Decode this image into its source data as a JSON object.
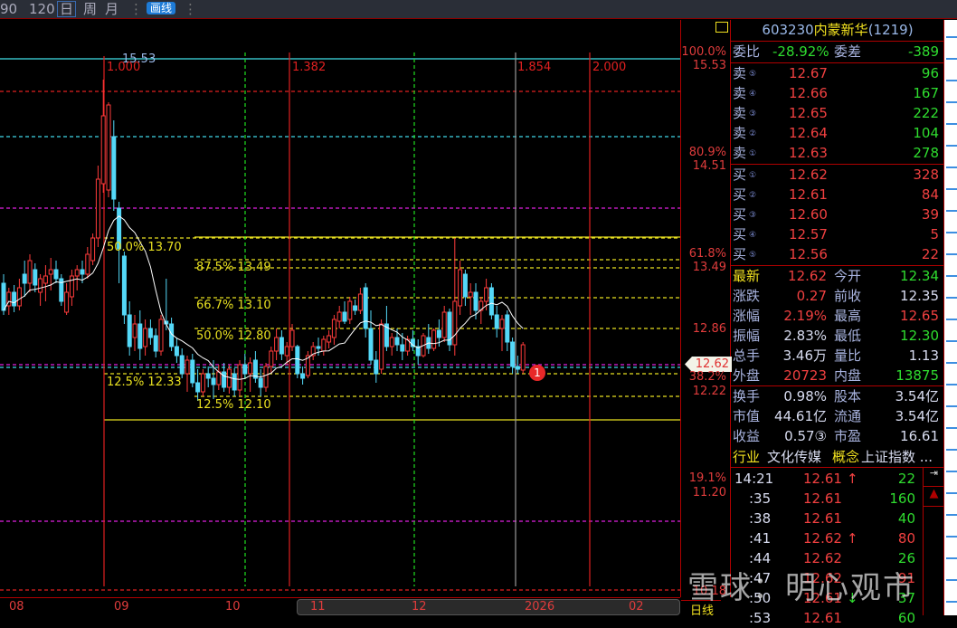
{
  "toolbar": {
    "items": [
      "90",
      "120",
      "日",
      "周",
      "月"
    ],
    "selected": "日",
    "draw_button": "画线"
  },
  "chart": {
    "top_price_label": "15.53",
    "ratios": [
      "1.000",
      "1.382",
      "1.854",
      "2.000"
    ],
    "fib_labels": [
      "50.0% 13.70",
      "87.5% 13.49",
      "66.7% 13.10",
      "50.0% 12.80",
      "12.5% 12.33",
      "12.5% 12.10"
    ],
    "marker": "1",
    "colors": {
      "up": "#ff3b3b",
      "down": "#54d8f8",
      "ma": "#ffffff"
    },
    "ohlc": [
      [
        13.3,
        13.4,
        12.95,
        13.0
      ],
      [
        13.05,
        13.25,
        12.95,
        13.2
      ],
      [
        13.2,
        13.28,
        12.98,
        13.05
      ],
      [
        13.05,
        13.35,
        13.0,
        13.25
      ],
      [
        13.4,
        13.55,
        13.15,
        13.3
      ],
      [
        13.3,
        13.62,
        13.2,
        13.55
      ],
      [
        13.45,
        13.52,
        13.2,
        13.28
      ],
      [
        13.2,
        13.4,
        13.05,
        13.35
      ],
      [
        13.3,
        13.5,
        13.1,
        13.38
      ],
      [
        13.4,
        13.58,
        13.22,
        13.45
      ],
      [
        13.45,
        13.55,
        13.3,
        13.35
      ],
      [
        13.35,
        13.4,
        13.05,
        13.1
      ],
      [
        12.98,
        13.3,
        12.95,
        13.2
      ],
      [
        13.15,
        13.45,
        13.05,
        13.38
      ],
      [
        13.38,
        13.5,
        13.22,
        13.45
      ],
      [
        13.45,
        13.55,
        13.3,
        13.4
      ],
      [
        13.4,
        13.7,
        13.35,
        13.62
      ],
      [
        13.55,
        13.85,
        13.5,
        13.8
      ],
      [
        13.8,
        14.6,
        13.7,
        14.45
      ],
      [
        14.4,
        15.55,
        14.3,
        15.15
      ],
      [
        14.33,
        15.3,
        14.25,
        15.27
      ],
      [
        14.92,
        15.1,
        14.1,
        14.23
      ],
      [
        14.13,
        14.2,
        13.3,
        13.68
      ],
      [
        13.6,
        13.65,
        12.85,
        12.95
      ],
      [
        12.95,
        13.1,
        12.5,
        12.6
      ],
      [
        12.7,
        12.95,
        12.55,
        12.85
      ],
      [
        12.85,
        13.0,
        12.45,
        12.58
      ],
      [
        12.6,
        12.9,
        12.5,
        12.8
      ],
      [
        12.8,
        12.9,
        12.62,
        12.7
      ],
      [
        12.72,
        12.8,
        12.48,
        12.55
      ],
      [
        12.55,
        12.95,
        12.5,
        12.9
      ],
      [
        12.88,
        13.35,
        12.78,
        12.85
      ],
      [
        12.85,
        12.92,
        12.55,
        12.6
      ],
      [
        12.6,
        12.7,
        12.42,
        12.5
      ],
      [
        12.5,
        12.58,
        12.25,
        12.3
      ],
      [
        12.3,
        12.5,
        12.1,
        12.45
      ],
      [
        12.45,
        12.52,
        12.15,
        12.2
      ],
      [
        12.2,
        12.35,
        12.0,
        12.1
      ],
      [
        12.1,
        12.35,
        12.05,
        12.3
      ],
      [
        12.3,
        12.38,
        12.15,
        12.25
      ],
      [
        12.25,
        12.45,
        12.02,
        12.18
      ],
      [
        12.18,
        12.4,
        12.12,
        12.32
      ],
      [
        12.32,
        12.42,
        12.1,
        12.15
      ],
      [
        12.15,
        12.4,
        12.08,
        12.35
      ],
      [
        12.3,
        12.36,
        12.05,
        12.12
      ],
      [
        12.12,
        12.45,
        12.05,
        12.4
      ],
      [
        12.4,
        12.52,
        12.25,
        12.3
      ],
      [
        12.3,
        12.48,
        12.1,
        12.42
      ],
      [
        12.45,
        12.55,
        12.2,
        12.25
      ],
      [
        12.25,
        12.35,
        12.05,
        12.15
      ],
      [
        12.15,
        12.42,
        12.1,
        12.38
      ],
      [
        12.38,
        12.6,
        12.3,
        12.55
      ],
      [
        12.55,
        12.8,
        12.45,
        12.7
      ],
      [
        12.7,
        12.78,
        12.45,
        12.52
      ],
      [
        12.5,
        12.65,
        12.4,
        12.6
      ],
      [
        12.6,
        12.85,
        12.55,
        12.78
      ],
      [
        12.6,
        12.62,
        12.25,
        12.3
      ],
      [
        12.3,
        12.38,
        12.18,
        12.25
      ],
      [
        12.28,
        12.55,
        12.25,
        12.5
      ],
      [
        12.5,
        12.65,
        12.45,
        12.6
      ],
      [
        12.6,
        12.7,
        12.5,
        12.58
      ],
      [
        12.55,
        12.72,
        12.5,
        12.68
      ],
      [
        12.65,
        12.78,
        12.58,
        12.72
      ],
      [
        12.7,
        12.95,
        12.62,
        12.9
      ],
      [
        12.88,
        13.05,
        12.8,
        12.98
      ],
      [
        12.98,
        13.1,
        12.85,
        12.88
      ],
      [
        12.9,
        13.15,
        12.85,
        13.1
      ],
      [
        13.05,
        13.12,
        12.95,
        13.0
      ],
      [
        13.0,
        13.25,
        12.96,
        13.18
      ],
      [
        13.25,
        13.3,
        12.7,
        12.8
      ],
      [
        12.8,
        13.0,
        12.4,
        12.45
      ],
      [
        12.45,
        12.55,
        12.2,
        12.3
      ],
      [
        12.35,
        12.9,
        12.3,
        12.85
      ],
      [
        12.85,
        13.05,
        12.55,
        12.6
      ],
      [
        12.6,
        12.75,
        12.5,
        12.7
      ],
      [
        12.7,
        12.8,
        12.55,
        12.62
      ],
      [
        12.62,
        12.75,
        12.45,
        12.55
      ],
      [
        12.55,
        12.72,
        12.5,
        12.68
      ],
      [
        12.68,
        12.78,
        12.55,
        12.6
      ],
      [
        12.6,
        12.68,
        12.4,
        12.5
      ],
      [
        12.5,
        12.75,
        12.48,
        12.72
      ],
      [
        12.7,
        12.85,
        12.52,
        12.58
      ],
      [
        12.58,
        12.8,
        12.55,
        12.78
      ],
      [
        12.78,
        12.9,
        12.6,
        12.7
      ],
      [
        12.7,
        13.05,
        12.65,
        12.98
      ],
      [
        12.98,
        13.02,
        12.55,
        12.62
      ],
      [
        12.62,
        13.8,
        12.5,
        13.1
      ],
      [
        13.05,
        13.55,
        12.95,
        13.45
      ],
      [
        13.4,
        13.45,
        13.05,
        13.15
      ],
      [
        13.15,
        13.3,
        12.95,
        13.2
      ],
      [
        13.2,
        13.3,
        12.9,
        13.0
      ],
      [
        13.0,
        13.15,
        12.85,
        13.1
      ],
      [
        13.1,
        13.35,
        13.0,
        13.25
      ],
      [
        13.25,
        13.3,
        12.9,
        12.95
      ],
      [
        12.95,
        13.05,
        12.7,
        12.8
      ],
      [
        12.8,
        12.95,
        12.55,
        12.9
      ],
      [
        12.95,
        13.0,
        12.55,
        12.65
      ],
      [
        12.65,
        12.7,
        12.3,
        12.38
      ],
      [
        12.38,
        12.5,
        12.3,
        12.35
      ],
      [
        12.34,
        12.65,
        12.3,
        12.62
      ]
    ]
  },
  "axis": {
    "labels": [
      [
        "100.0%",
        "15.53"
      ],
      [
        "80.9%",
        "14.51"
      ],
      [
        "61.8%",
        "13.49"
      ],
      [
        "",
        "12.86"
      ],
      [
        "38.2%",
        "12.22"
      ],
      [
        "19.1%",
        "11.20"
      ],
      [
        "",
        "10.18"
      ]
    ],
    "current": "12.62",
    "period": "日线"
  },
  "dates": [
    "08",
    "09",
    "10",
    "11",
    "12",
    "2026",
    "02"
  ],
  "panel": {
    "code": "603230",
    "name": "内蒙新华",
    "count": "(1219)",
    "weibi_label": "委比",
    "weibi": "-28.92%",
    "weicha_label": "委差",
    "weicha": "-389",
    "sells": [
      {
        "l": "卖",
        "n": "⑤",
        "p": "12.67",
        "v": "96"
      },
      {
        "l": "卖",
        "n": "④",
        "p": "12.66",
        "v": "167"
      },
      {
        "l": "卖",
        "n": "③",
        "p": "12.65",
        "v": "222"
      },
      {
        "l": "卖",
        "n": "②",
        "p": "12.64",
        "v": "104"
      },
      {
        "l": "卖",
        "n": "①",
        "p": "12.63",
        "v": "278"
      }
    ],
    "buys": [
      {
        "l": "买",
        "n": "①",
        "p": "12.62",
        "v": "328"
      },
      {
        "l": "买",
        "n": "②",
        "p": "12.61",
        "v": "84"
      },
      {
        "l": "买",
        "n": "③",
        "p": "12.60",
        "v": "39"
      },
      {
        "l": "买",
        "n": "④",
        "p": "12.57",
        "v": "5"
      },
      {
        "l": "买",
        "n": "⑤",
        "p": "12.56",
        "v": "22"
      }
    ],
    "stats": [
      [
        "最新",
        "12.62",
        "今开",
        "12.34"
      ],
      [
        "涨跌",
        "0.27",
        "前收",
        "12.35"
      ],
      [
        "涨幅",
        "2.19%",
        "最高",
        "12.65"
      ],
      [
        "振幅",
        "2.83%",
        "最低",
        "12.30"
      ],
      [
        "总手",
        "3.46万",
        "量比",
        "1.13"
      ],
      [
        "外盘",
        "20723",
        "内盘",
        "13875"
      ]
    ],
    "info": [
      [
        "换手",
        "0.98%",
        "股本",
        "3.54亿"
      ],
      [
        "市值",
        "44.61亿",
        "流通",
        "3.54亿"
      ],
      [
        "收益",
        "0.57③",
        "市盈",
        "16.61"
      ]
    ],
    "industry_label": "行业",
    "industry": "文化传媒",
    "concept_label": "概念",
    "concept": "上证指数 ...",
    "ticks": [
      [
        "14:21",
        "12.61",
        "↑",
        "22"
      ],
      [
        ":35",
        "12.61",
        "",
        "160"
      ],
      [
        ":38",
        "12.61",
        "",
        "40"
      ],
      [
        ":41",
        "12.62",
        "↑",
        "80"
      ],
      [
        ":44",
        "12.62",
        "",
        "26"
      ],
      [
        ":47",
        "12.62",
        "",
        "91"
      ],
      [
        ":50",
        "12.61",
        "↓",
        "37"
      ],
      [
        ":53",
        "12.61",
        "",
        "60"
      ]
    ]
  },
  "watermark": "雪球：明心观市"
}
